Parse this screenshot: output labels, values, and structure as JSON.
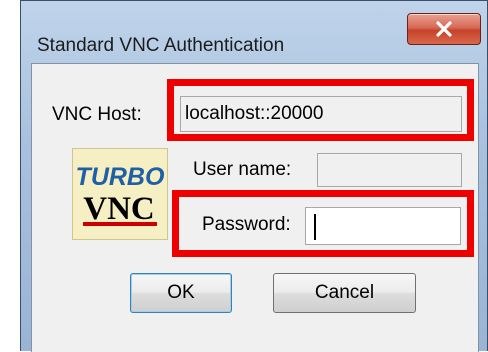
{
  "window": {
    "title": "Standard VNC Authentication",
    "close_icon": "close-x-icon"
  },
  "form": {
    "host_label": "VNC Host:",
    "host_value": "localhost::20000",
    "username_label": "User name:",
    "username_value": "",
    "password_label": "Password:",
    "password_value": ""
  },
  "logo": {
    "top_text": "TURBO",
    "bottom_text": "VNC"
  },
  "buttons": {
    "ok_label": "OK",
    "cancel_label": "Cancel"
  },
  "colors": {
    "highlight": "#ee0000",
    "close_button": "#c6432b",
    "logo_turbo": "#1f5fa8",
    "logo_vnc": "#000000",
    "logo_underline": "#cc0000"
  }
}
